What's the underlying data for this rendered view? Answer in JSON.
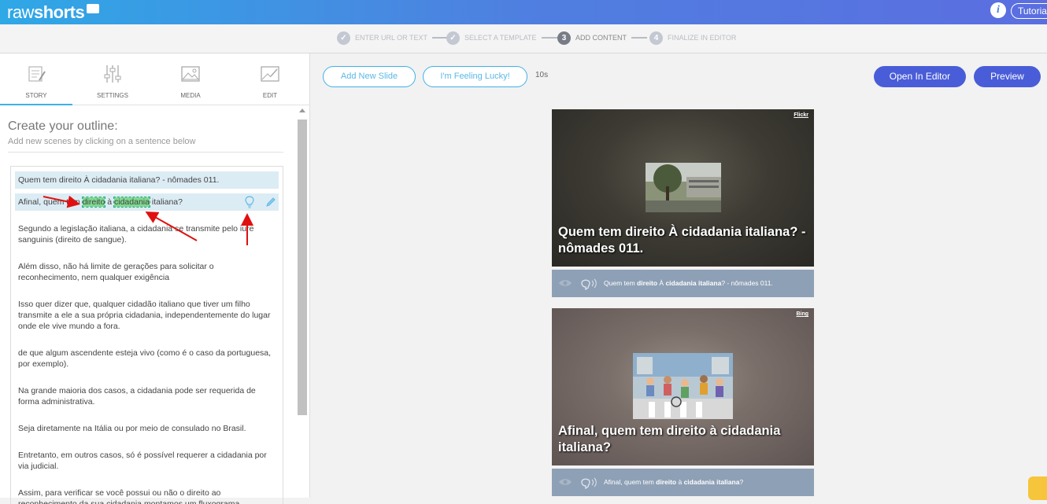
{
  "app": {
    "logo_light": "raw",
    "logo_bold": "shorts",
    "tutorial_label": "Tutorial",
    "info_icon": "info-icon"
  },
  "steps": [
    {
      "label": "ENTER URL OR TEXT",
      "state": "done",
      "icon": "check-circle-icon"
    },
    {
      "label": "SELECT A TEMPLATE",
      "state": "done",
      "icon": "check-circle-icon"
    },
    {
      "label": "ADD CONTENT",
      "state": "active",
      "number": "3"
    },
    {
      "label": "FINALIZE IN EDITOR",
      "state": "todo",
      "number": "4"
    }
  ],
  "tabs": [
    {
      "label": "STORY",
      "icon": "story-icon",
      "active": true
    },
    {
      "label": "SETTINGS",
      "icon": "sliders-icon",
      "active": false
    },
    {
      "label": "MEDIA",
      "icon": "image-icon",
      "active": false
    },
    {
      "label": "EDIT",
      "icon": "edit-image-icon",
      "active": false
    }
  ],
  "outline": {
    "title": "Create your outline:",
    "subtitle": "Add new scenes by clicking on a sentence below",
    "first_sentence": "Quem tem direito À cidadania italiana? - nômades 011.",
    "second_sentence": {
      "before": "Afinal, quem tem ",
      "hl1": "direito",
      "middle": " à ",
      "hl2": "cidadania",
      "after": " italiana?"
    },
    "paragraphs": [
      "Segundo a legislação italiana, a cidadania se transmite pelo iure sanguinis (direito de sangue).",
      "Além disso, não há limite de gerações para solicitar o reconhecimento, nem qualquer exigência",
      "Isso quer dizer que, qualquer cidadão italiano que tiver um filho transmite a ele a sua própria cidadania, independentemente do lugar onde ele vive mundo a fora.",
      "de que algum ascendente esteja vivo (como é o caso da portuguesa, por exemplo).",
      "Na grande maioria dos casos, a cidadania pode ser requerida de forma administrativa.",
      "Seja diretamente na Itália ou por meio de consulado no Brasil.",
      "Entretanto, em outros casos, só é possível requerer a cidadania por via judicial.",
      "Assim, para verificar se você possui ou não o direito ao reconhecimento da sua cidadania montamos um fluxograma detalhado."
    ]
  },
  "toolbar": {
    "add_slide": "Add New Slide",
    "feeling_lucky": "I'm Feeling Lucky!",
    "duration": "10s",
    "open_editor": "Open In Editor",
    "preview": "Preview"
  },
  "slides": [
    {
      "source": "Flickr",
      "title": "Quem tem direito À cidadania italiana? - nômades 011.",
      "caption_pre": "Quem tem ",
      "caption_b1": "direito",
      "caption_mid": " À ",
      "caption_b2": "cidadania italiana",
      "caption_post": "? - nômades 011."
    },
    {
      "source": "Bing",
      "title": "Afinal, quem tem direito à cidadania italiana?",
      "caption_pre": "Afinal, quem tem ",
      "caption_b1": "direito",
      "caption_mid": " à ",
      "caption_b2": "cidadania italiana",
      "caption_post": "?"
    }
  ],
  "colors": {
    "brand_gradient_start": "#2fa8e6",
    "brand_gradient_end": "#5b6ee0",
    "primary_button": "#4a5dd8",
    "highlight": "#7fd98f",
    "caption_bar": "#8ea0b6"
  }
}
